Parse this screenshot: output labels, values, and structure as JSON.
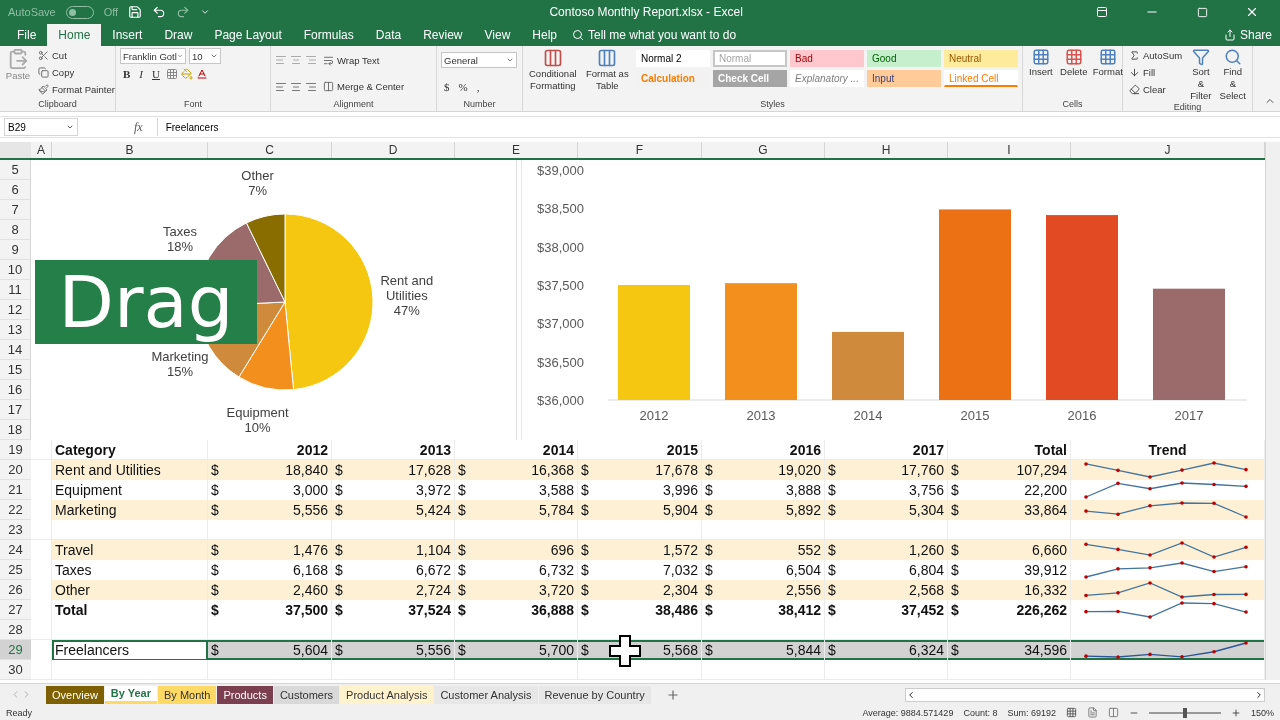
{
  "title_bar": {
    "autosave": {
      "label": "AutoSave",
      "state_text": "Off",
      "on": false
    },
    "title": "Contoso Monthly Report.xlsx  -  Excel"
  },
  "menu": {
    "tabs": [
      {
        "label": "File",
        "selected": false
      },
      {
        "label": "Home",
        "selected": true
      },
      {
        "label": "Insert",
        "selected": false
      },
      {
        "label": "Draw",
        "selected": false
      },
      {
        "label": "Page Layout",
        "selected": false
      },
      {
        "label": "Formulas",
        "selected": false
      },
      {
        "label": "Data",
        "selected": false
      },
      {
        "label": "Review",
        "selected": false
      },
      {
        "label": "View",
        "selected": false
      },
      {
        "label": "Help",
        "selected": false
      }
    ],
    "search": {
      "placeholder": "Tell me what you want to do"
    },
    "share": "Share"
  },
  "ribbon": {
    "groups": [
      {
        "kind": "clipboard",
        "label": "Clipboard",
        "paste": "Paste",
        "items": [
          "Cut",
          "Copy",
          "Format Painter"
        ]
      },
      {
        "kind": "font",
        "label": "Font",
        "font_name": "Franklin Gotl",
        "font_size": "10",
        "buttons": [
          "B",
          "I",
          "U"
        ]
      },
      {
        "kind": "alignment",
        "label": "Alignment",
        "items": [
          "Wrap Text",
          "Merge & Center"
        ]
      },
      {
        "kind": "number",
        "label": "Number",
        "format": "General",
        "symbols": [
          "$",
          "%",
          ","
        ]
      },
      {
        "kind": "styles",
        "label": "Styles",
        "big": [
          "Conditional Formatting",
          "Format as Table"
        ],
        "cells": [
          {
            "text": "Normal 2",
            "color": "#ffffff",
            "kind": "normal2"
          },
          {
            "text": "Normal",
            "color": "#ffffff",
            "kind": "normal"
          },
          {
            "text": "Bad",
            "color": "#ffc7ce",
            "kind": "bad"
          },
          {
            "text": "Good",
            "color": "#c6efce",
            "kind": "good"
          },
          {
            "text": "Neutral",
            "color": "#ffeb9c",
            "kind": "neutral"
          },
          {
            "text": "Calculation",
            "color": "#f2f2f2",
            "kind": "calculation"
          },
          {
            "text": "Check Cell",
            "color": "#a5a5a5",
            "kind": "check"
          },
          {
            "text": "Explanatory ...",
            "color": "#ffffff",
            "kind": "explanatory"
          },
          {
            "text": "Input",
            "color": "#ffcc99",
            "kind": "input"
          },
          {
            "text": "Linked Cell",
            "color": "#ffffff",
            "kind": "linked"
          }
        ]
      },
      {
        "kind": "cells",
        "label": "Cells",
        "items": [
          "Insert",
          "Delete",
          "Format"
        ]
      },
      {
        "kind": "editing",
        "label": "Editing",
        "small": [
          "AutoSum",
          "Fill",
          "Clear"
        ],
        "big": [
          "Sort & Filter",
          "Find & Select"
        ]
      }
    ]
  },
  "formula_bar": {
    "name_box": "B29",
    "fx": "fx",
    "value": "Freelancers"
  },
  "columns": [
    "A",
    "B",
    "C",
    "D",
    "E",
    "F",
    "G",
    "H",
    "I",
    "J"
  ],
  "chart_rows": [
    "5",
    "6",
    "7",
    "8",
    "9",
    "10",
    "11",
    "12",
    "13",
    "14",
    "15",
    "16",
    "17",
    "18"
  ],
  "pie": {
    "chart_data": {
      "type": "pie",
      "categories": [
        "Rent and Utilities",
        "Equipment",
        "Marketing",
        "Taxes",
        "Other"
      ],
      "values": [
        47,
        10,
        15,
        18,
        7
      ],
      "colors": [
        "#f5c710",
        "#f3901d",
        "#d08a3c",
        "#9b6a6a",
        "#8a6d00"
      ],
      "value_labels": [
        "47%",
        "10%",
        "15%",
        "18%",
        "7%"
      ]
    }
  },
  "bar": {
    "chart_data": {
      "type": "bar",
      "categories": [
        "2012",
        "2013",
        "2014",
        "2015",
        "2016",
        "2017"
      ],
      "series": [
        {
          "values": [
            37500,
            37524,
            36888,
            38486,
            38412,
            37452
          ]
        }
      ],
      "colors": [
        "#f5c710",
        "#f3901d",
        "#d08a3c",
        "#ec7115",
        "#e24a24",
        "#9b6a6a"
      ],
      "ylim": [
        36000,
        39000
      ],
      "yticks": [
        {
          "value": 36000,
          "label": "$36,000"
        },
        {
          "value": 36500,
          "label": "$36,500"
        },
        {
          "value": 37000,
          "label": "$37,000"
        },
        {
          "value": 37500,
          "label": "$37,500"
        },
        {
          "value": 38000,
          "label": "$38,000"
        },
        {
          "value": 38500,
          "label": "$38,500"
        },
        {
          "value": 39000,
          "label": "$39,000"
        }
      ]
    }
  },
  "overlay": {
    "caption": "Drag"
  },
  "table": {
    "rows": [
      {
        "num": "19",
        "kind": "header",
        "cells": [
          "Category",
          "2012",
          "2013",
          "2014",
          "2015",
          "2016",
          "2017",
          "Total",
          "Trend"
        ]
      },
      {
        "num": "20",
        "kind": "data",
        "banded": true,
        "selected": false,
        "label": "Rent and Utilities",
        "amounts": [
          [
            "$",
            "18,840"
          ],
          [
            "$",
            "17,628"
          ],
          [
            "$",
            "16,368"
          ],
          [
            "$",
            "17,678"
          ],
          [
            "$",
            "19,020"
          ],
          [
            "$",
            "17,760"
          ],
          [
            "$",
            "107,294"
          ]
        ]
      },
      {
        "num": "21",
        "kind": "data",
        "banded": false,
        "selected": false,
        "label": "Equipment",
        "amounts": [
          [
            "$",
            "3,000"
          ],
          [
            "$",
            "3,972"
          ],
          [
            "$",
            "3,588"
          ],
          [
            "$",
            "3,996"
          ],
          [
            "$",
            "3,888"
          ],
          [
            "$",
            "3,756"
          ],
          [
            "$",
            "22,200"
          ]
        ]
      },
      {
        "num": "22",
        "kind": "data",
        "banded": true,
        "selected": false,
        "label": "Marketing",
        "amounts": [
          [
            "$",
            "5,556"
          ],
          [
            "$",
            "5,424"
          ],
          [
            "$",
            "5,784"
          ],
          [
            "$",
            "5,904"
          ],
          [
            "$",
            "5,892"
          ],
          [
            "$",
            "5,304"
          ],
          [
            "$",
            "33,864"
          ]
        ]
      },
      {
        "num": "23",
        "kind": "blank"
      },
      {
        "num": "24",
        "kind": "data",
        "banded": true,
        "selected": false,
        "label": "Travel",
        "amounts": [
          [
            "$",
            "1,476"
          ],
          [
            "$",
            "1,104"
          ],
          [
            "$",
            "696"
          ],
          [
            "$",
            "1,572"
          ],
          [
            "$",
            "552"
          ],
          [
            "$",
            "1,260"
          ],
          [
            "$",
            "6,660"
          ]
        ]
      },
      {
        "num": "25",
        "kind": "data",
        "banded": false,
        "selected": false,
        "label": "Taxes",
        "amounts": [
          [
            "$",
            "6,168"
          ],
          [
            "$",
            "6,672"
          ],
          [
            "$",
            "6,732"
          ],
          [
            "$",
            "7,032"
          ],
          [
            "$",
            "6,504"
          ],
          [
            "$",
            "6,804"
          ],
          [
            "$",
            "39,912"
          ]
        ]
      },
      {
        "num": "26",
        "kind": "data",
        "banded": true,
        "selected": false,
        "label": "Other",
        "amounts": [
          [
            "$",
            "2,460"
          ],
          [
            "$",
            "2,724"
          ],
          [
            "$",
            "3,720"
          ],
          [
            "$",
            "2,304"
          ],
          [
            "$",
            "2,556"
          ],
          [
            "$",
            "2,568"
          ],
          [
            "$",
            "16,332"
          ]
        ]
      },
      {
        "num": "27",
        "kind": "total",
        "banded": false,
        "selected": false,
        "label": "Total",
        "amounts": [
          [
            "$",
            "37,500"
          ],
          [
            "$",
            "37,524"
          ],
          [
            "$",
            "36,888"
          ],
          [
            "$",
            "38,486"
          ],
          [
            "$",
            "38,412"
          ],
          [
            "$",
            "37,452"
          ],
          [
            "$",
            "226,262"
          ]
        ]
      },
      {
        "num": "28",
        "kind": "blank"
      },
      {
        "num": "29",
        "kind": "data",
        "selected": true,
        "label": "Freelancers",
        "amounts": [
          [
            "$",
            "5,604"
          ],
          [
            "$",
            "5,556"
          ],
          [
            "$",
            "5,700"
          ],
          [
            "$",
            "5,568"
          ],
          [
            "$",
            "5,844"
          ],
          [
            "$",
            "6,324"
          ],
          [
            "$",
            "34,596"
          ]
        ]
      },
      {
        "num": "30",
        "kind": "blank"
      }
    ]
  },
  "sheet_tabs": [
    {
      "label": "Overview",
      "selected": false,
      "color": "#7f6000"
    },
    {
      "label": "By Year",
      "selected": true,
      "color": "#ffd966"
    },
    {
      "label": "By Month",
      "selected": false,
      "color": "#ffd966"
    },
    {
      "label": "Products",
      "selected": false,
      "color": "#7b3f4f"
    },
    {
      "label": "Customers",
      "selected": false,
      "color": "#d9d9d9"
    },
    {
      "label": "Product Analysis",
      "selected": false,
      "color": "#fff2cc"
    },
    {
      "label": "Customer Analysis",
      "selected": false,
      "color": "#e7e7e7"
    },
    {
      "label": "Revenue by Country",
      "selected": false,
      "color": "#e7e7e7"
    }
  ],
  "status_bar": {
    "status": "Ready",
    "stats": [
      "Average: 9884.571429",
      "Count: 8",
      "Sum: 69192"
    ],
    "zoom": {
      "level": 0.5,
      "reading": "150%"
    }
  }
}
